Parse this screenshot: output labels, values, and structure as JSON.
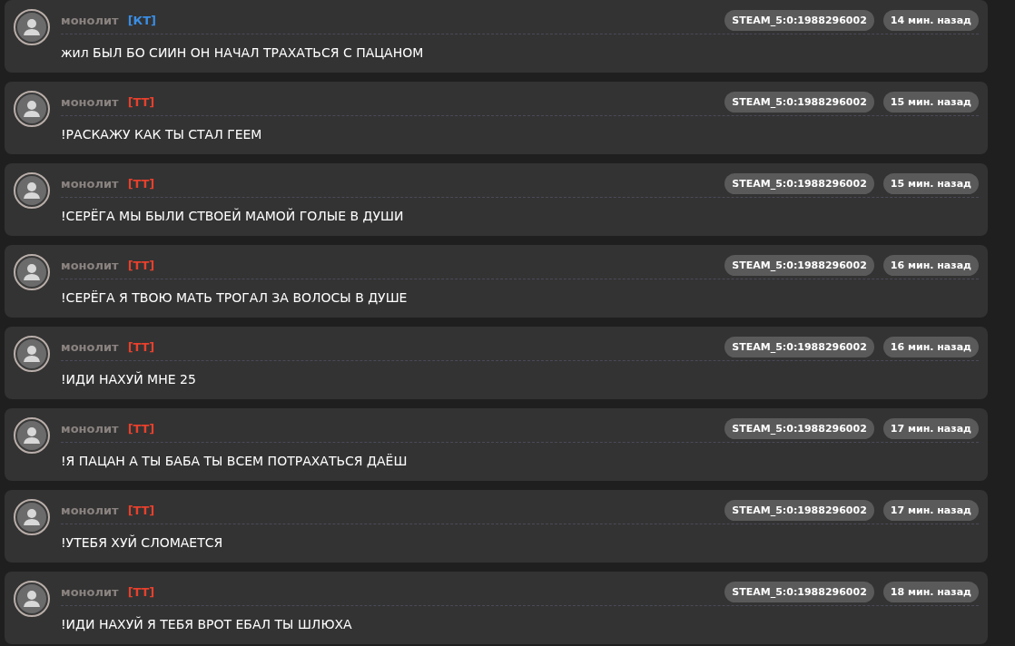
{
  "messages": [
    {
      "name": "монолит",
      "team": "[КТ]",
      "color": "#3a8ee6",
      "steam_id": "STEAM_5:0:1988296002",
      "time": "14 мин. назад",
      "text": "жил БЫЛ БО СИИН ОН НАЧАЛ ТРАХАТЬСЯ С ПАЦАНОМ"
    },
    {
      "name": "монолит",
      "team": "[ТТ]",
      "color": "#e8402c",
      "steam_id": "STEAM_5:0:1988296002",
      "time": "15 мин. назад",
      "text": "!РАСКАЖУ КАК ТЫ СТАЛ ГЕЕМ"
    },
    {
      "name": "монолит",
      "team": "[ТТ]",
      "color": "#e8402c",
      "steam_id": "STEAM_5:0:1988296002",
      "time": "15 мин. назад",
      "text": "!СЕРЁГА МЫ БЫЛИ СТВОЕЙ МАМОЙ ГОЛЫЕ В ДУШИ"
    },
    {
      "name": "монолит",
      "team": "[ТТ]",
      "color": "#e8402c",
      "steam_id": "STEAM_5:0:1988296002",
      "time": "16 мин. назад",
      "text": "!СЕРЁГА Я ТВОЮ МАТЬ ТРОГАЛ ЗА ВОЛОСЫ В ДУШЕ"
    },
    {
      "name": "монолит",
      "team": "[ТТ]",
      "color": "#e8402c",
      "steam_id": "STEAM_5:0:1988296002",
      "time": "16 мин. назад",
      "text": "!ИДИ НАХУЙ МНЕ 25"
    },
    {
      "name": "монолит",
      "team": "[ТТ]",
      "color": "#e8402c",
      "steam_id": "STEAM_5:0:1988296002",
      "time": "17 мин. назад",
      "text": "!Я ПАЦАН А ТЫ БАБА ТЫ ВСЕМ ПОТРАХАТЬСЯ ДАЁШ"
    },
    {
      "name": "монолит",
      "team": "[ТТ]",
      "color": "#e8402c",
      "steam_id": "STEAM_5:0:1988296002",
      "time": "17 мин. назад",
      "text": "!УТЕБЯ ХУЙ СЛОМАЕТСЯ"
    },
    {
      "name": "монолит",
      "team": "[ТТ]",
      "color": "#e8402c",
      "steam_id": "STEAM_5:0:1988296002",
      "time": "18 мин. назад",
      "text": "!ИДИ НАХУЙ Я ТЕБЯ ВРОТ ЕБАЛ ТЫ ШЛЮХА"
    }
  ]
}
